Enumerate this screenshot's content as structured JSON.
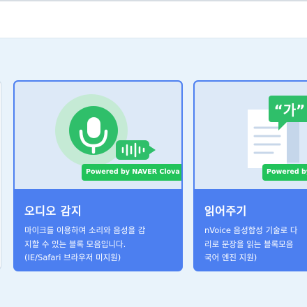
{
  "cards": [
    {
      "title": "오디오 감지",
      "badge": "Powered by NAVER Clova",
      "description": [
        "마이크를 이용하여 소리와 음성을 감",
        "지할 수 있는 블록 모음입니다.",
        "(IE/Safari 브라우저 미지원)"
      ],
      "icon": "microphone-icon"
    },
    {
      "title": "읽어주기",
      "badge": "Powered by NAVER Clova",
      "bubble_text": "“가”",
      "description": [
        "nVoice 음성합성 기술로 다",
        "리로 문장을 읽는 블록모음",
        "국어 엔진 지원)"
      ],
      "icon": "document-speech-icon"
    }
  ],
  "colors": {
    "page_background": "#e9f3fb",
    "card_accent": "#4c7ff0",
    "badge_green": "#22c35a"
  }
}
